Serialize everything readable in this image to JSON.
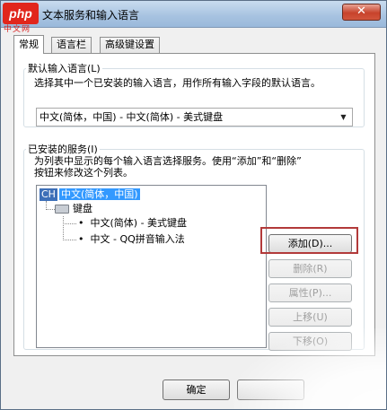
{
  "window": {
    "title": "文本服务和输入语言",
    "close_label": "✕"
  },
  "watermark": {
    "logo": "php",
    "sub": "中文网"
  },
  "tabs": [
    {
      "label": "常规",
      "active": true
    },
    {
      "label": "语言栏",
      "active": false
    },
    {
      "label": "高级键设置",
      "active": false
    }
  ],
  "default_lang": {
    "title": "默认输入语言(L)",
    "description": "选择其中一个已安装的输入语言，用作所有输入字段的默认语言。",
    "selected": "中文(简体，中国) - 中文(简体) - 美式键盘"
  },
  "installed": {
    "title": "已安装的服务(I)",
    "description_line1": "为列表中显示的每个输入语言选择服务。使用“添加”和“删除”",
    "description_line2": "按钮来修改这个列表。",
    "tree": {
      "lang_code": "CH",
      "lang_name": "中文(简体，中国)",
      "category": "键盘",
      "items": [
        "中文(简体) - 美式键盘",
        "中文 - QQ拼音输入法"
      ]
    },
    "buttons": {
      "add": "添加(D)...",
      "remove": "删除(R)",
      "properties": "属性(P)...",
      "move_up": "上移(U)",
      "move_down": "下移(O)"
    }
  },
  "footer": {
    "ok": "确定"
  }
}
